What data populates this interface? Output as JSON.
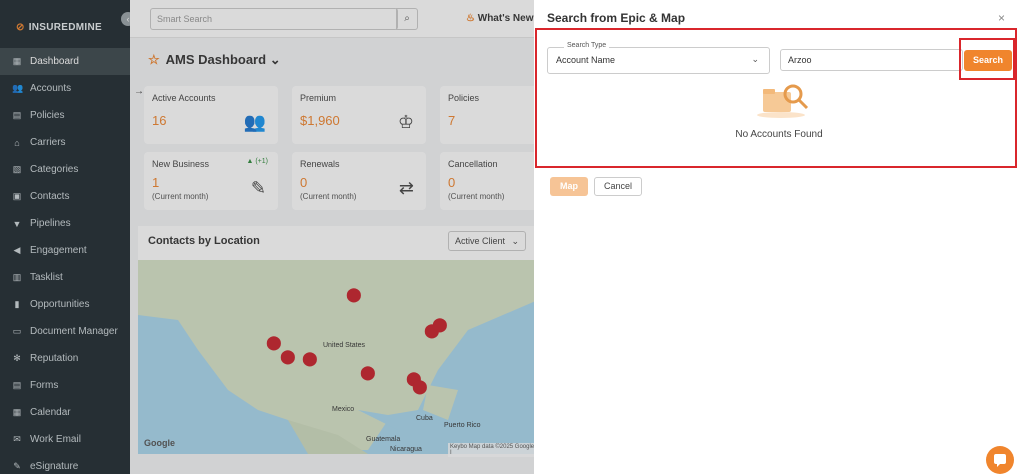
{
  "sidebar": {
    "logo": "INSUREDMINE",
    "items": [
      {
        "label": "Dashboard",
        "icon": "dashboard-icon",
        "active": true
      },
      {
        "label": "Accounts",
        "icon": "accounts-icon"
      },
      {
        "label": "Policies",
        "icon": "policies-icon"
      },
      {
        "label": "Carriers",
        "icon": "carriers-icon"
      },
      {
        "label": "Categories",
        "icon": "categories-icon"
      },
      {
        "label": "Contacts",
        "icon": "contacts-icon"
      },
      {
        "label": "Pipelines",
        "icon": "pipelines-icon"
      },
      {
        "label": "Engagement",
        "icon": "megaphone-icon"
      },
      {
        "label": "Tasklist",
        "icon": "tasklist-icon"
      },
      {
        "label": "Opportunities",
        "icon": "opportunities-icon"
      },
      {
        "label": "Document Manager",
        "icon": "folder-icon"
      },
      {
        "label": "Reputation",
        "icon": "reputation-icon"
      },
      {
        "label": "Forms",
        "icon": "forms-icon"
      },
      {
        "label": "Calendar",
        "icon": "calendar-icon"
      },
      {
        "label": "Work Email",
        "icon": "email-icon"
      },
      {
        "label": "eSignature",
        "icon": "signature-icon"
      }
    ]
  },
  "topbar": {
    "search_placeholder": "Smart Search",
    "whats_new": "What's New"
  },
  "dashboard": {
    "title": "AMS Dashboard",
    "cards": [
      {
        "label": "Active Accounts",
        "value": "16",
        "sub": ""
      },
      {
        "label": "Premium",
        "value": "$1,960",
        "sub": ""
      },
      {
        "label": "Policies",
        "value": "7",
        "sub": ""
      },
      {
        "label": "New Business",
        "value": "1",
        "sub": "(Current month)",
        "badge": "▲ (+1)"
      },
      {
        "label": "Renewals",
        "value": "0",
        "sub": "(Current month)"
      },
      {
        "label": "Cancellation",
        "value": "0",
        "sub": "(Current month)"
      }
    ],
    "map": {
      "title": "Contacts by Location",
      "filter": "Active Client",
      "labels": {
        "us": "United States",
        "mexico": "Mexico",
        "cuba": "Cuba",
        "pr": "Puerto Rico",
        "guatemala": "Guatemala",
        "nicaragua": "Nicaragua"
      },
      "google": "Google",
      "footer": "Keybo  Map data ©2025 Google, I"
    }
  },
  "modal": {
    "title": "Search from Epic & Map",
    "search_type_label": "Search Type",
    "search_type_value": "Account Name",
    "query_value": "Arzoo",
    "search_button": "Search",
    "empty_message": "No Accounts Found",
    "map_button": "Map",
    "cancel_button": "Cancel"
  },
  "colors": {
    "accent": "#f0852d",
    "highlight": "#d9262c",
    "sidebar": "#1f2a30"
  }
}
